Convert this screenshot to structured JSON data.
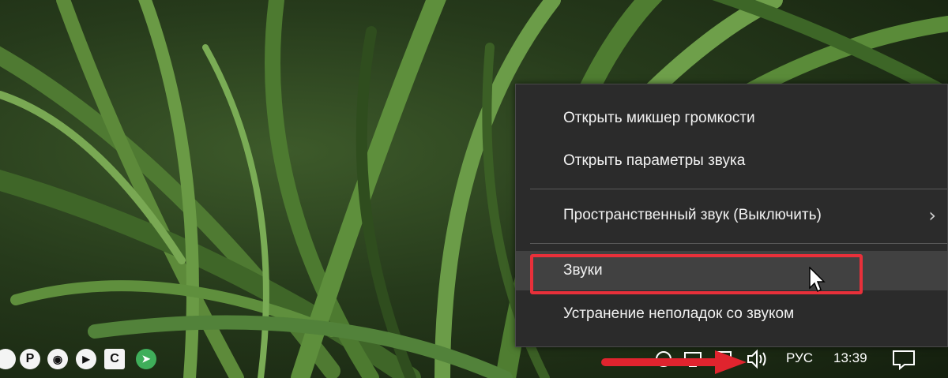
{
  "context_menu": {
    "items": [
      {
        "label": "Открыть микшер громкости"
      },
      {
        "label": "Открыть параметры звука"
      },
      {
        "label": "Пространственный звук (Выключить)",
        "has_submenu": true
      },
      {
        "label": "Звуки",
        "hovered": true,
        "highlighted": true
      },
      {
        "label": "Устранение неполадок со звуком"
      }
    ]
  },
  "taskbar": {
    "tray_apps": [
      {
        "icon": "p-app-icon",
        "glyph": "P"
      },
      {
        "icon": "disc-app-icon",
        "glyph": "◉"
      },
      {
        "icon": "play-app-icon",
        "glyph": "▶"
      },
      {
        "icon": "c-app-icon",
        "glyph": "C"
      },
      {
        "icon": "telegram-icon",
        "glyph": "➤"
      }
    ],
    "volume_icon": "speaker-icon",
    "language": "РУС",
    "time": "13:39",
    "notifications_icon": "action-center-icon"
  },
  "colors": {
    "menu_bg": "#2b2b2b",
    "highlight": "#e8303a",
    "telegram": "#3fae5a"
  }
}
